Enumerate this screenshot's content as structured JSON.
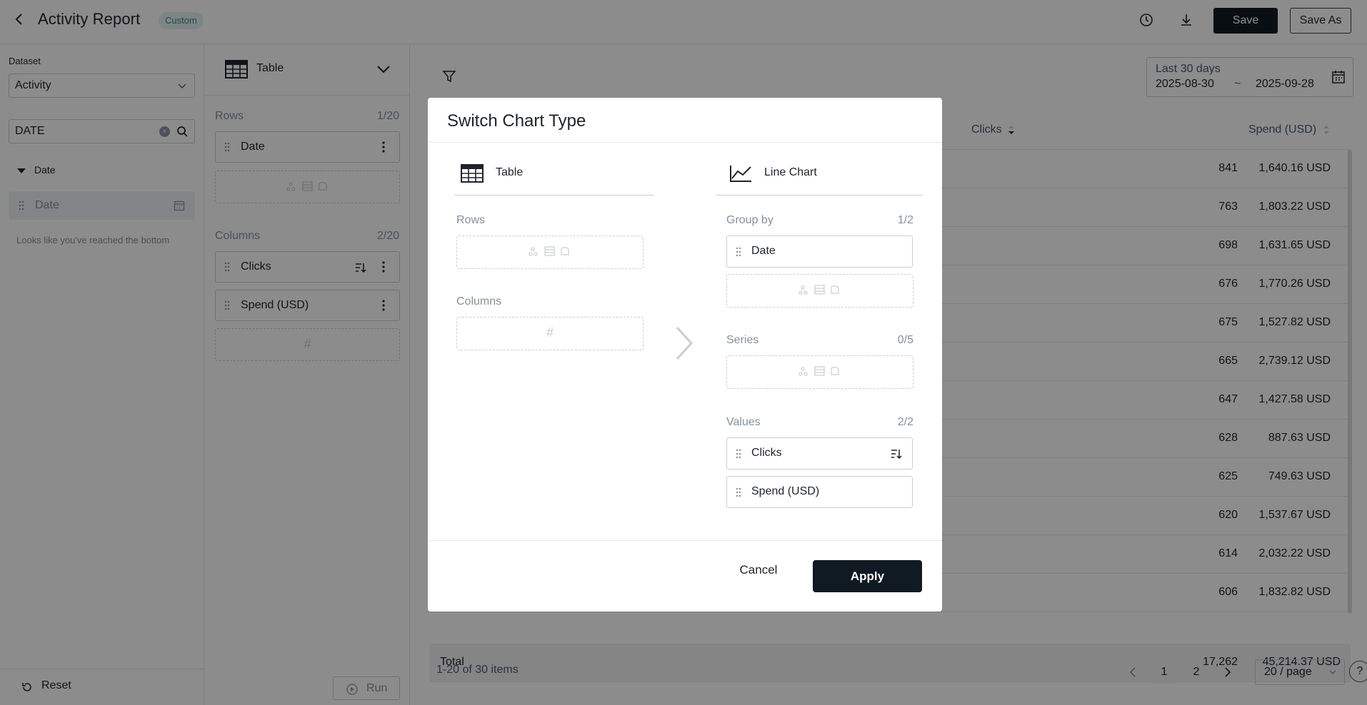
{
  "header": {
    "title": "Activity Report",
    "badge": "Custom",
    "save_label": "Save",
    "save_as_label": "Save As"
  },
  "left_panel": {
    "dataset_label": "Dataset",
    "dataset_value": "Activity",
    "search_value": "DATE",
    "tree_group": "Date",
    "tree_item": "Date",
    "hint": "Looks like you've reached the bottom",
    "reset_label": "Reset",
    "run_label": "Run"
  },
  "config_panel": {
    "chart_type": "Table",
    "rows_label": "Rows",
    "rows_count": "1/20",
    "rows": [
      "Date"
    ],
    "columns_label": "Columns",
    "columns_count": "2/20",
    "columns": [
      "Clicks",
      "Spend (USD)"
    ],
    "hash": "#"
  },
  "main": {
    "date_range_label": "Last 30 days",
    "date_from": "2025-08-30",
    "date_sep": "~",
    "date_to": "2025-09-28",
    "columns": [
      "Clicks",
      "Spend (USD)"
    ],
    "rows": [
      {
        "clicks": "841",
        "spend": "1,640.16 USD"
      },
      {
        "clicks": "763",
        "spend": "1,803.22 USD"
      },
      {
        "clicks": "698",
        "spend": "1,631.65 USD"
      },
      {
        "clicks": "676",
        "spend": "1,770.26 USD"
      },
      {
        "clicks": "675",
        "spend": "1,527.82 USD"
      },
      {
        "clicks": "665",
        "spend": "2,739.12 USD"
      },
      {
        "clicks": "647",
        "spend": "1,427.58 USD"
      },
      {
        "clicks": "628",
        "spend": "887.63 USD"
      },
      {
        "clicks": "625",
        "spend": "749.63 USD"
      },
      {
        "clicks": "620",
        "spend": "1,537.67 USD"
      },
      {
        "clicks": "614",
        "spend": "2,032.22 USD"
      },
      {
        "clicks": "606",
        "spend": "1,832.82 USD"
      }
    ],
    "total_label": "Total",
    "total_clicks": "17,262",
    "total_spend": "45,214.37 USD",
    "pager_info": "1-20 of 30 items",
    "pages": [
      "1",
      "2"
    ],
    "page_size": "20 / page",
    "help": "?"
  },
  "modal": {
    "title": "Switch Chart Type",
    "from_type": "Table",
    "to_type": "Line Chart",
    "from_rows_label": "Rows",
    "from_columns_label": "Columns",
    "hash": "#",
    "group_by_label": "Group by",
    "group_by_count": "1/2",
    "group_by_item": "Date",
    "series_label": "Series",
    "series_count": "0/5",
    "values_label": "Values",
    "values_count": "2/2",
    "values_items": [
      "Clicks",
      "Spend (USD)"
    ],
    "cancel_label": "Cancel",
    "apply_label": "Apply"
  },
  "colors": {
    "primary_button": "#0f1a22",
    "badge_bg": "#e3f0ef",
    "badge_text": "#3b8a84",
    "overlay": "rgba(0,0,0,0.45)"
  }
}
